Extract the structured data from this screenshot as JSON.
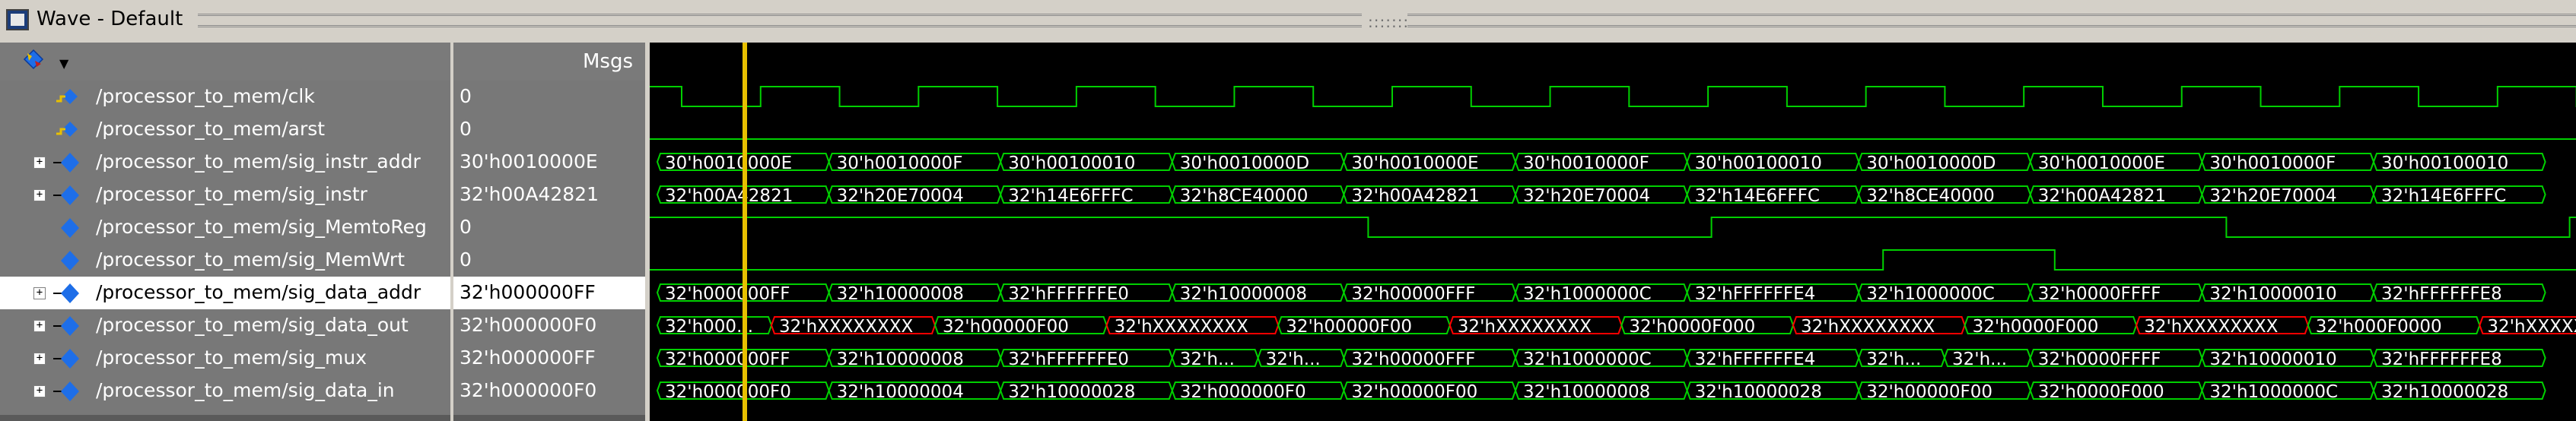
{
  "window": {
    "title": "Wave - Default",
    "grip_glyph": ":::::::"
  },
  "header": {
    "msgs_label": "Msgs",
    "toolbar_icon": "diamond-signal-icon",
    "dropdown_icon": "chevron-down-icon"
  },
  "colors": {
    "wave": "#00d000",
    "text": "#ffffff",
    "unknown": "#ff0000",
    "cursor": "#e8c000",
    "signal_icon": "#1e6ee8"
  },
  "signals": [
    {
      "name": "/processor_to_mem/clk",
      "value": "0",
      "expandable": false,
      "icon": "clock-diamond-icon"
    },
    {
      "name": "/processor_to_mem/arst",
      "value": "0",
      "expandable": false,
      "icon": "input-diamond-icon"
    },
    {
      "name": "/processor_to_mem/sig_instr_addr",
      "value": "30'h0010000E",
      "expandable": true,
      "icon": "bus-diamond-icon"
    },
    {
      "name": "/processor_to_mem/sig_instr",
      "value": "32'h00A42821",
      "expandable": true,
      "icon": "bus-diamond-icon"
    },
    {
      "name": "/processor_to_mem/sig_MemtoReg",
      "value": "0",
      "expandable": false,
      "icon": "signal-diamond-icon"
    },
    {
      "name": "/processor_to_mem/sig_MemWrt",
      "value": "0",
      "expandable": false,
      "icon": "signal-diamond-icon"
    },
    {
      "name": "/processor_to_mem/sig_data_addr",
      "value": "32'h000000FF",
      "expandable": true,
      "icon": "bus-diamond-icon",
      "selected": true
    },
    {
      "name": "/processor_to_mem/sig_data_out",
      "value": "32'h000000F0",
      "expandable": true,
      "icon": "bus-diamond-icon"
    },
    {
      "name": "/processor_to_mem/sig_mux",
      "value": "32'h000000FF",
      "expandable": true,
      "icon": "bus-diamond-icon"
    },
    {
      "name": "/processor_to_mem/sig_data_in",
      "value": "32'h000000F0",
      "expandable": true,
      "icon": "bus-diamond-icon"
    }
  ],
  "waves": {
    "clk": {
      "transitions": [
        0,
        10,
        20,
        30,
        40,
        50,
        60,
        70,
        80,
        90,
        100,
        110,
        120,
        130,
        140,
        150,
        160,
        170,
        180,
        190,
        200,
        210,
        220,
        230
      ],
      "start_level": 0
    },
    "arst": {
      "level": 0
    },
    "sig_MemtoReg": {
      "transitions": [
        40,
        60,
        90,
        110
      ],
      "start_level": 1
    },
    "sig_MemWrt": {
      "transitions": [
        70,
        80,
        130,
        140
      ],
      "start_level": 0
    },
    "bus": {
      "sig_instr_addr": [
        "30'h0010000E",
        "30'h0010000F",
        "30'h00100010",
        "30'h0010000D",
        "30'h0010000E",
        "30'h0010000F",
        "30'h00100010",
        "30'h0010000D",
        "30'h0010000E",
        "30'h0010000F",
        "30'h00100010"
      ],
      "sig_instr": [
        "32'h00A42821",
        "32'h20E70004",
        "32'h14E6FFFC",
        "32'h8CE40000",
        "32'h00A42821",
        "32'h20E70004",
        "32'h14E6FFFC",
        "32'h8CE40000",
        "32'h00A42821",
        "32'h20E70004",
        "32'h14E6FFFC"
      ],
      "sig_data_addr": [
        "32'h000000FF",
        "32'h10000008",
        "32'hFFFFFFE0",
        "32'h10000008",
        "32'h00000FFF",
        "32'h1000000C",
        "32'hFFFFFFE4",
        "32'h1000000C",
        "32'h0000FFFF",
        "32'h10000010",
        "32'hFFFFFFE8"
      ],
      "sig_data_out": [
        "32'h000...",
        "32'hXXXXXXXX",
        "32'h00000F00",
        "32'hXXXXXXXX",
        "32'h00000F00",
        "32'hXXXXXXXX",
        "32'h0000F000",
        "32'hXXXXXXXX",
        "32'h0000F000",
        "32'hXXXXXXXX",
        "32'h000F0000",
        "32'hXXXXX"
      ],
      "sig_mux": [
        "32'h000000FF",
        "32'h10000008",
        "32'hFFFFFFE0",
        "32'h...",
        "32'h...",
        "32'h00000FFF",
        "32'h1000000C",
        "32'hFFFFFFE4",
        "32'h...",
        "32'h...",
        "32'h0000FFFF",
        "32'h10000010",
        "32'hFFFFFFE8"
      ],
      "sig_data_in": [
        "32'h000000F0",
        "32'h10000004",
        "32'h10000028",
        "32'h000000F0",
        "32'h00000F00",
        "32'h10000008",
        "32'h10000028",
        "32'h00000F00",
        "32'h0000F000",
        "32'h1000000C",
        "32'h10000028"
      ]
    }
  }
}
